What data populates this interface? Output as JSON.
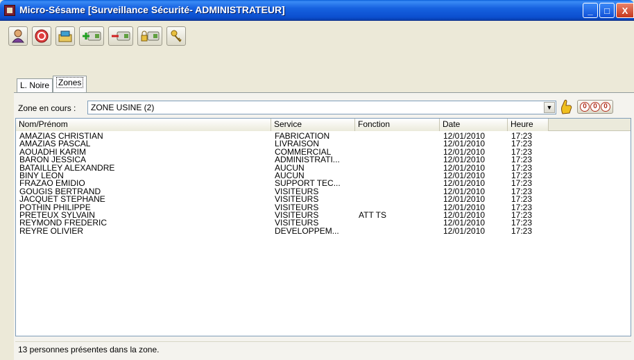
{
  "window": {
    "title": "Micro-Sésame [Surveillance Sécurité- ADMINISTRATEUR]",
    "minimize": "_",
    "maximize": "□",
    "close": "X"
  },
  "toolbar": {
    "icons": [
      "user-icon",
      "stop-icon",
      "card-reader-icon",
      "add-card-icon",
      "remove-card-icon",
      "lock-card-icon",
      "key-icon"
    ]
  },
  "tabs": [
    {
      "label": "L. Noire",
      "active": false
    },
    {
      "label": "Zones",
      "active": true
    }
  ],
  "zone": {
    "label": "Zone en cours :",
    "value": "ZONE USINE (2)",
    "counter": [
      "0",
      "0",
      "0"
    ]
  },
  "table": {
    "columns": [
      "Nom/Prénom",
      "Service",
      "Fonction",
      "Date",
      "Heure"
    ],
    "rows": [
      [
        "AMAZIAS CHRISTIAN",
        "FABRICATION",
        "",
        "12/01/2010",
        "17:23"
      ],
      [
        "AMAZIAS PASCAL",
        "LIVRAISON",
        "",
        "12/01/2010",
        "17:23"
      ],
      [
        "AOUADHI KARIM",
        "COMMERCIAL",
        "",
        "12/01/2010",
        "17:23"
      ],
      [
        "BARON JESSICA",
        "ADMINISTRATI...",
        "",
        "12/01/2010",
        "17:23"
      ],
      [
        "BATAILLEY ALEXANDRE",
        "AUCUN",
        "",
        "12/01/2010",
        "17:23"
      ],
      [
        "BINY LEON",
        "AUCUN",
        "",
        "12/01/2010",
        "17:23"
      ],
      [
        "FRAZAO EMIDIO",
        "SUPPORT TEC...",
        "",
        "12/01/2010",
        "17:23"
      ],
      [
        "GOUGIS BERTRAND",
        "VISITEURS",
        "",
        "12/01/2010",
        "17:23"
      ],
      [
        "JACQUET STEPHANE",
        "VISITEURS",
        "",
        "12/01/2010",
        "17:23"
      ],
      [
        "POTHIN PHILIPPE",
        "VISITEURS",
        "",
        "12/01/2010",
        "17:23"
      ],
      [
        "PRETEUX SYLVAIN",
        "VISITEURS",
        "ATT TS",
        "12/01/2010",
        "17:23"
      ],
      [
        "REYMOND FREDERIC",
        "VISITEURS",
        "",
        "12/01/2010",
        "17:23"
      ],
      [
        "REYRE OLIVIER",
        "DEVELOPPEM...",
        "",
        "12/01/2010",
        "17:23"
      ]
    ]
  },
  "status": "13 personnes présentes dans la zone."
}
